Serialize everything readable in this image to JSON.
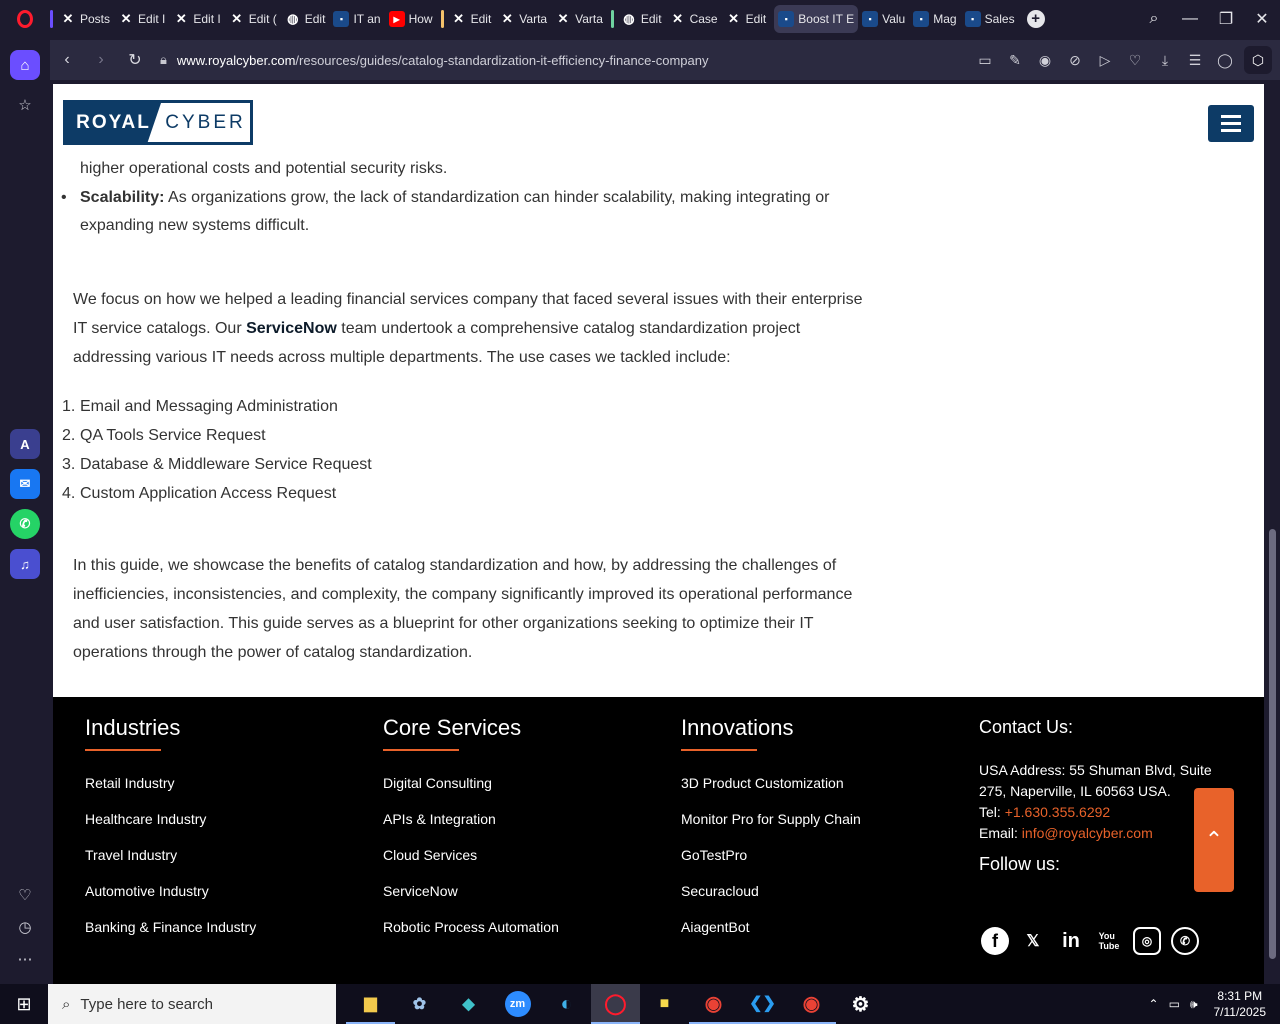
{
  "browser": {
    "tabs": [
      {
        "label": "Posts",
        "icon": "x"
      },
      {
        "label": "Edit I",
        "icon": "x"
      },
      {
        "label": "Edit I",
        "icon": "x"
      },
      {
        "label": "Edit (",
        "icon": "x"
      },
      {
        "label": "Edit",
        "icon": "globe"
      },
      {
        "label": "IT an",
        "icon": "doc"
      },
      {
        "label": "How",
        "icon": "yt"
      },
      {
        "label": "Edit",
        "icon": "x"
      },
      {
        "label": "Varta",
        "icon": "x"
      },
      {
        "label": "Varta",
        "icon": "x"
      },
      {
        "label": "Edit",
        "icon": "globe"
      },
      {
        "label": "Case",
        "icon": "x"
      },
      {
        "label": "Edit",
        "icon": "x"
      },
      {
        "label": "Boost IT E",
        "icon": "doc"
      },
      {
        "label": "Valu",
        "icon": "doc"
      },
      {
        "label": "Mag",
        "icon": "doc"
      },
      {
        "label": "Sales",
        "icon": "doc"
      }
    ],
    "url_domain": "www.royalcyber.com",
    "url_path": "/resources/guides/catalog-standardization-it-efficiency-finance-company"
  },
  "site": {
    "logo_left": "ROYAL",
    "logo_right": "CYBER"
  },
  "article": {
    "cut_line": "higher operational costs and potential security risks.",
    "bullet_label": "Scalability:",
    "bullet_text": " As organizations grow, the lack of standardization can hinder scalability, making integrating or expanding new systems difficult.",
    "para1_a": "We focus on how we helped a leading financial services company that faced several issues with their enterprise IT service catalogs. Our ",
    "para1_bold": "ServiceNow",
    "para1_b": " team undertook a comprehensive catalog standardization project addressing various IT needs across multiple departments. The use cases we tackled include:",
    "use_cases": [
      "Email and Messaging Administration",
      "QA Tools Service Request",
      "Database & Middleware Service Request",
      "Custom Application Access Request"
    ],
    "para2": "In this guide, we showcase the benefits of catalog standardization and how, by addressing the challenges of inefficiencies, inconsistencies, and complexity, the company significantly improved its operational performance and user satisfaction. This guide serves as a blueprint for other organizations seeking to optimize their IT operations through the power of catalog standardization."
  },
  "footer": {
    "industries": {
      "title": "Industries",
      "items": [
        "Retail Industry",
        "Healthcare Industry",
        "Travel Industry",
        "Automotive Industry",
        "Banking & Finance Industry"
      ]
    },
    "services": {
      "title": "Core Services",
      "items": [
        "Digital Consulting",
        "APIs & Integration",
        "Cloud Services",
        "ServiceNow",
        "Robotic Process Automation"
      ]
    },
    "innovations": {
      "title": "Innovations",
      "items": [
        "3D Product Customization",
        "Monitor Pro for Supply Chain",
        "GoTestPro",
        "Securacloud",
        "AiagentBot"
      ]
    },
    "contact": {
      "title": "Contact Us:",
      "address": "USA Address: 55 Shuman Blvd, Suite 275, Naperville, IL 60563 USA.",
      "tel_label": "Tel: ",
      "tel": "+1.630.355.6292",
      "email_label": "Email: ",
      "email": "info@royalcyber.com",
      "follow": "Follow us:"
    }
  },
  "taskbar": {
    "search_placeholder": "Type here to search",
    "time": "8:31 PM",
    "date": "7/11/2025"
  },
  "colors": {
    "brand_navy": "#0d3b66",
    "accent_orange": "#e8622a",
    "opera_red": "#ff1b2d",
    "sidebar_active": "#6b4eff"
  }
}
